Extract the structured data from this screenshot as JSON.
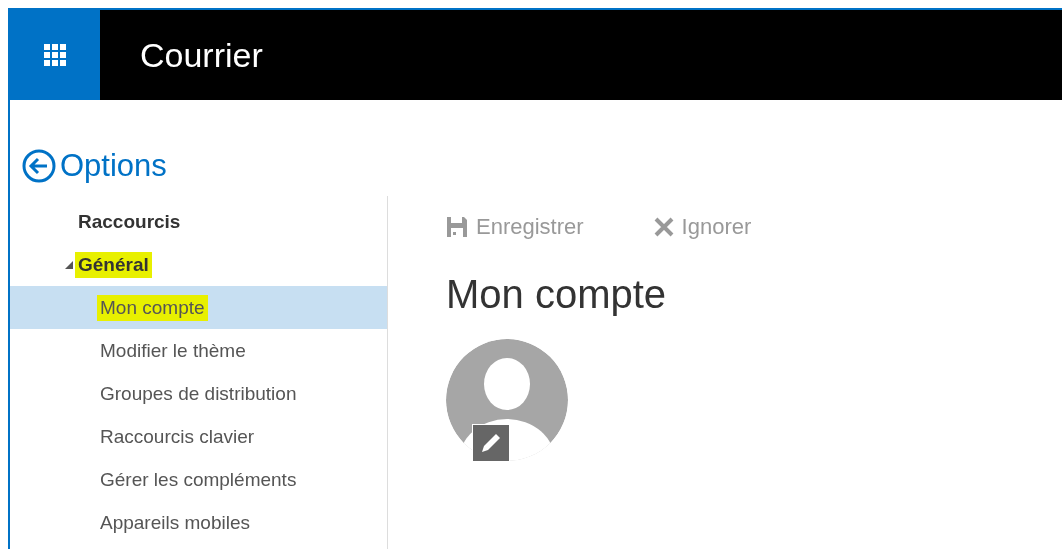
{
  "header": {
    "title": "Courrier"
  },
  "options": {
    "title": "Options"
  },
  "nav": [
    {
      "label": "Raccourcis",
      "selected": false,
      "highlighted": false
    },
    {
      "label": "Général",
      "selected": false,
      "highlighted": true,
      "expanded": true,
      "children": [
        {
          "label": "Mon compte",
          "selected": true,
          "highlighted": true
        },
        {
          "label": "Modifier le thème",
          "selected": false,
          "highlighted": false
        },
        {
          "label": "Groupes de distribution",
          "selected": false,
          "highlighted": false
        },
        {
          "label": "Raccourcis clavier",
          "selected": false,
          "highlighted": false
        },
        {
          "label": "Gérer les compléments",
          "selected": false,
          "highlighted": false
        },
        {
          "label": "Appareils mobiles",
          "selected": false,
          "highlighted": false
        }
      ]
    }
  ],
  "toolbar": [
    {
      "kind": "save",
      "label": "Enregistrer",
      "disabled": true
    },
    {
      "kind": "discard",
      "label": "Ignorer",
      "disabled": true
    }
  ],
  "content": {
    "heading": "Mon compte"
  }
}
